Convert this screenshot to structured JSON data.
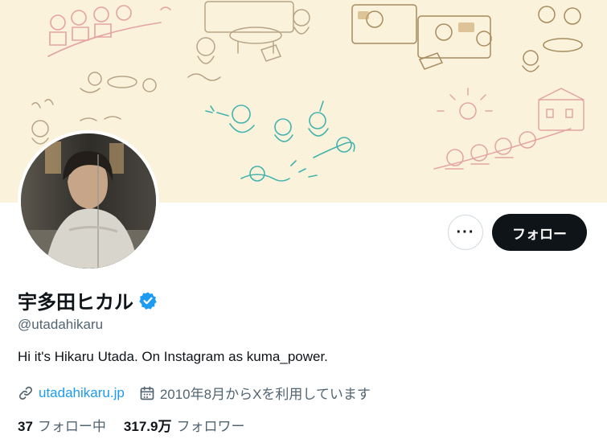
{
  "profile": {
    "display_name": "宇多田ヒカル",
    "handle": "@utadahikaru",
    "bio": "Hi it's Hikaru Utada. On Instagram as kuma_power.",
    "website": "utadahikaru.jp",
    "joined": "2010年8月からXを利用しています"
  },
  "actions": {
    "more_label": "···",
    "follow_label": "フォロー"
  },
  "stats": {
    "following_count": "37",
    "following_label": "フォロー中",
    "followers_count": "317.9万",
    "followers_label": "フォロワー"
  },
  "colors": {
    "banner_bg": "#fbf2dc",
    "verified": "#1d9bf0",
    "link": "#1d9bf0",
    "follow_button": "#0f1419"
  },
  "icons": {
    "verified": "verified-badge-icon",
    "link": "link-icon",
    "calendar": "calendar-icon",
    "more": "more-icon"
  }
}
